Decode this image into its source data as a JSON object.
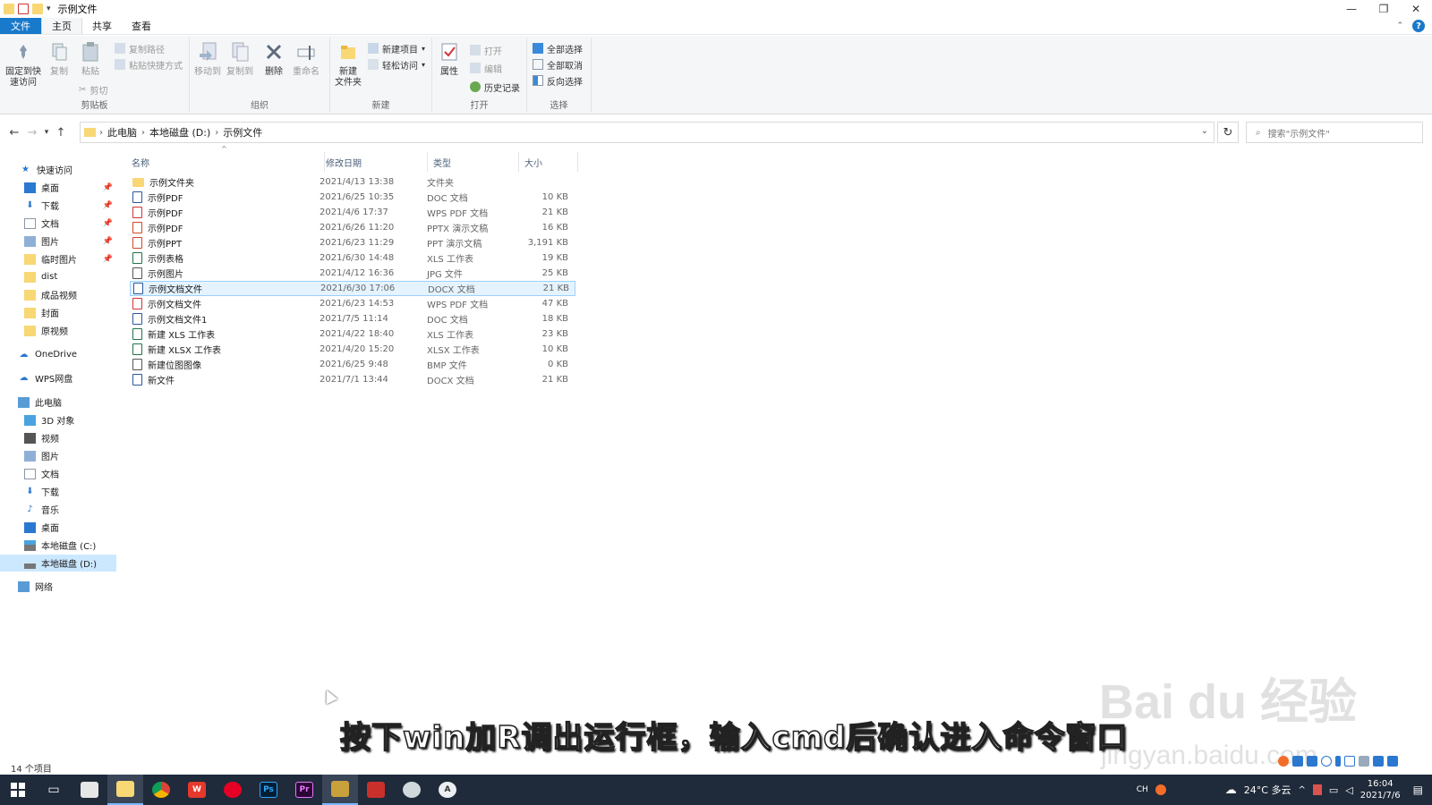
{
  "window": {
    "title": "示例文件"
  },
  "tabs": [
    {
      "label": "文件"
    },
    {
      "label": "主页"
    },
    {
      "label": "共享"
    },
    {
      "label": "查看"
    }
  ],
  "ribbon": {
    "clipboard": {
      "group_label": "剪贴板",
      "pin_label_1": "固定到快",
      "pin_label_2": "速访问",
      "copy_label": "复制",
      "paste_label": "粘贴",
      "copy_path_label": "复制路径",
      "paste_shortcut_label": "粘贴快捷方式",
      "cut_label": "剪切"
    },
    "organize": {
      "group_label": "组织",
      "move_to_label": "移动到",
      "copy_to_label": "复制到",
      "delete_label": "删除",
      "rename_label": "重命名"
    },
    "new": {
      "group_label": "新建",
      "new_folder_label_1": "新建",
      "new_folder_label_2": "文件夹",
      "new_item_label": "新建项目",
      "easy_access_label": "轻松访问"
    },
    "open": {
      "group_label": "打开",
      "properties_label": "属性",
      "open_label": "打开",
      "edit_label": "编辑",
      "history_label": "历史记录"
    },
    "select": {
      "group_label": "选择",
      "select_all_label": "全部选择",
      "select_none_label": "全部取消",
      "invert_label": "反向选择"
    }
  },
  "address": {
    "crumbs": [
      "此电脑",
      "本地磁盘 (D:)",
      "示例文件"
    ],
    "search_placeholder": "搜索\"示例文件\""
  },
  "nav": {
    "quick_access": "快速访问",
    "quick_items": [
      "桌面",
      "下载",
      "文档",
      "图片",
      "临时图片",
      "dist",
      "成品视频",
      "封面",
      "原视频"
    ],
    "onedrive": "OneDrive",
    "wps": "WPS网盘",
    "this_pc": "此电脑",
    "pc_items": [
      "3D 对象",
      "视频",
      "图片",
      "文档",
      "下载",
      "音乐",
      "桌面",
      "本地磁盘 (C:)",
      "本地磁盘 (D:)"
    ],
    "network": "网络"
  },
  "columns": {
    "name": "名称",
    "date": "修改日期",
    "type": "类型",
    "size": "大小"
  },
  "files": [
    {
      "name": "示例文件夹",
      "date": "2021/4/13 13:38",
      "type": "文件夹",
      "size": ""
    },
    {
      "name": "示例PDF",
      "date": "2021/6/25 10:35",
      "type": "DOC 文档",
      "size": "10 KB"
    },
    {
      "name": "示例PDF",
      "date": "2021/4/6 17:37",
      "type": "WPS PDF 文档",
      "size": "21 KB"
    },
    {
      "name": "示例PDF",
      "date": "2021/6/26 11:20",
      "type": "PPTX 演示文稿",
      "size": "16 KB"
    },
    {
      "name": "示例PPT",
      "date": "2021/6/23 11:29",
      "type": "PPT 演示文稿",
      "size": "3,191 KB"
    },
    {
      "name": "示例表格",
      "date": "2021/6/30 14:48",
      "type": "XLS 工作表",
      "size": "19 KB"
    },
    {
      "name": "示例图片",
      "date": "2021/4/12 16:36",
      "type": "JPG 文件",
      "size": "25 KB"
    },
    {
      "name": "示例文档文件",
      "date": "2021/6/30 17:06",
      "type": "DOCX 文档",
      "size": "21 KB"
    },
    {
      "name": "示例文档文件",
      "date": "2021/6/23 14:53",
      "type": "WPS PDF 文档",
      "size": "47 KB"
    },
    {
      "name": "示例文档文件1",
      "date": "2021/7/5 11:14",
      "type": "DOC 文档",
      "size": "18 KB"
    },
    {
      "name": "新建 XLS 工作表",
      "date": "2021/4/22 18:40",
      "type": "XLS 工作表",
      "size": "23 KB"
    },
    {
      "name": "新建 XLSX 工作表",
      "date": "2021/4/20 15:20",
      "type": "XLSX 工作表",
      "size": "10 KB"
    },
    {
      "name": "新建位图图像",
      "date": "2021/6/25 9:48",
      "type": "BMP 文件",
      "size": "0 KB"
    },
    {
      "name": "新文件",
      "date": "2021/7/1 13:44",
      "type": "DOCX 文档",
      "size": "21 KB"
    }
  ],
  "status": {
    "item_count": "14 个项目"
  },
  "overlay": {
    "subtitle": "按下win加R调出运行框，输入cmd后确认进入命令窗口",
    "watermark": "Bai du 经验",
    "watermark_url": "jingyan.baidu.com"
  },
  "taskbar": {
    "ime": "CH",
    "weather": "24°C 多云",
    "time": "16:04",
    "date": "2021/7/6",
    "app_labels": [
      "Ps",
      "Pr"
    ]
  },
  "colors": {
    "accent": "#1979ca",
    "selection": "#cce8ff",
    "folder": "#f8d775",
    "taskbar": "#1f2a3a"
  }
}
